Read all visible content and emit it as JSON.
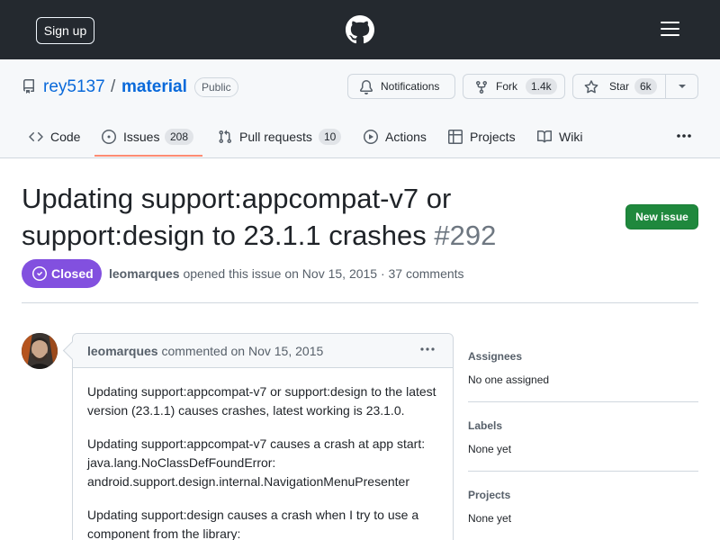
{
  "header": {
    "signup_label": "Sign up"
  },
  "repo": {
    "owner": "rey5137",
    "separator": "/",
    "name": "material",
    "visibility": "Public",
    "notifications_label": "Notifications",
    "fork_label": "Fork",
    "fork_count": "1.4k",
    "star_label": "Star",
    "star_count": "6k"
  },
  "tabs": [
    {
      "label": "Code"
    },
    {
      "label": "Issues",
      "count": "208"
    },
    {
      "label": "Pull requests",
      "count": "10"
    },
    {
      "label": "Actions"
    },
    {
      "label": "Projects"
    },
    {
      "label": "Wiki"
    }
  ],
  "issue": {
    "title": "Updating support:appcompat-v7 or support:design to 23.1.1 crashes",
    "number": "#292",
    "new_issue_label": "New issue",
    "state": "Closed",
    "author": "leomarques",
    "meta_text": "opened this issue on Nov 15, 2015 · 37 comments"
  },
  "comment": {
    "author": "leomarques",
    "meta_text": "commented on Nov 15, 2015",
    "paragraphs": [
      "Updating support:appcompat-v7 or support:design to the latest version (23.1.1) causes crashes, latest working is 23.1.0.",
      "Updating support:appcompat-v7 causes a crash at app start: java.lang.NoClassDefFoundError: android.support.design.internal.NavigationMenuPresenter",
      "Updating support:design causes a crash when I try to use a component from the library:"
    ]
  },
  "sidebar": {
    "assignees_title": "Assignees",
    "assignees_value": "No one assigned",
    "labels_title": "Labels",
    "labels_value": "None yet",
    "projects_title": "Projects",
    "projects_value": "None yet"
  },
  "colors": {
    "header_bg": "#24292f",
    "link": "#0969da",
    "closed_badge": "#8250df",
    "new_issue_button": "#1f883d",
    "active_tab_underline": "#fd8c73"
  }
}
